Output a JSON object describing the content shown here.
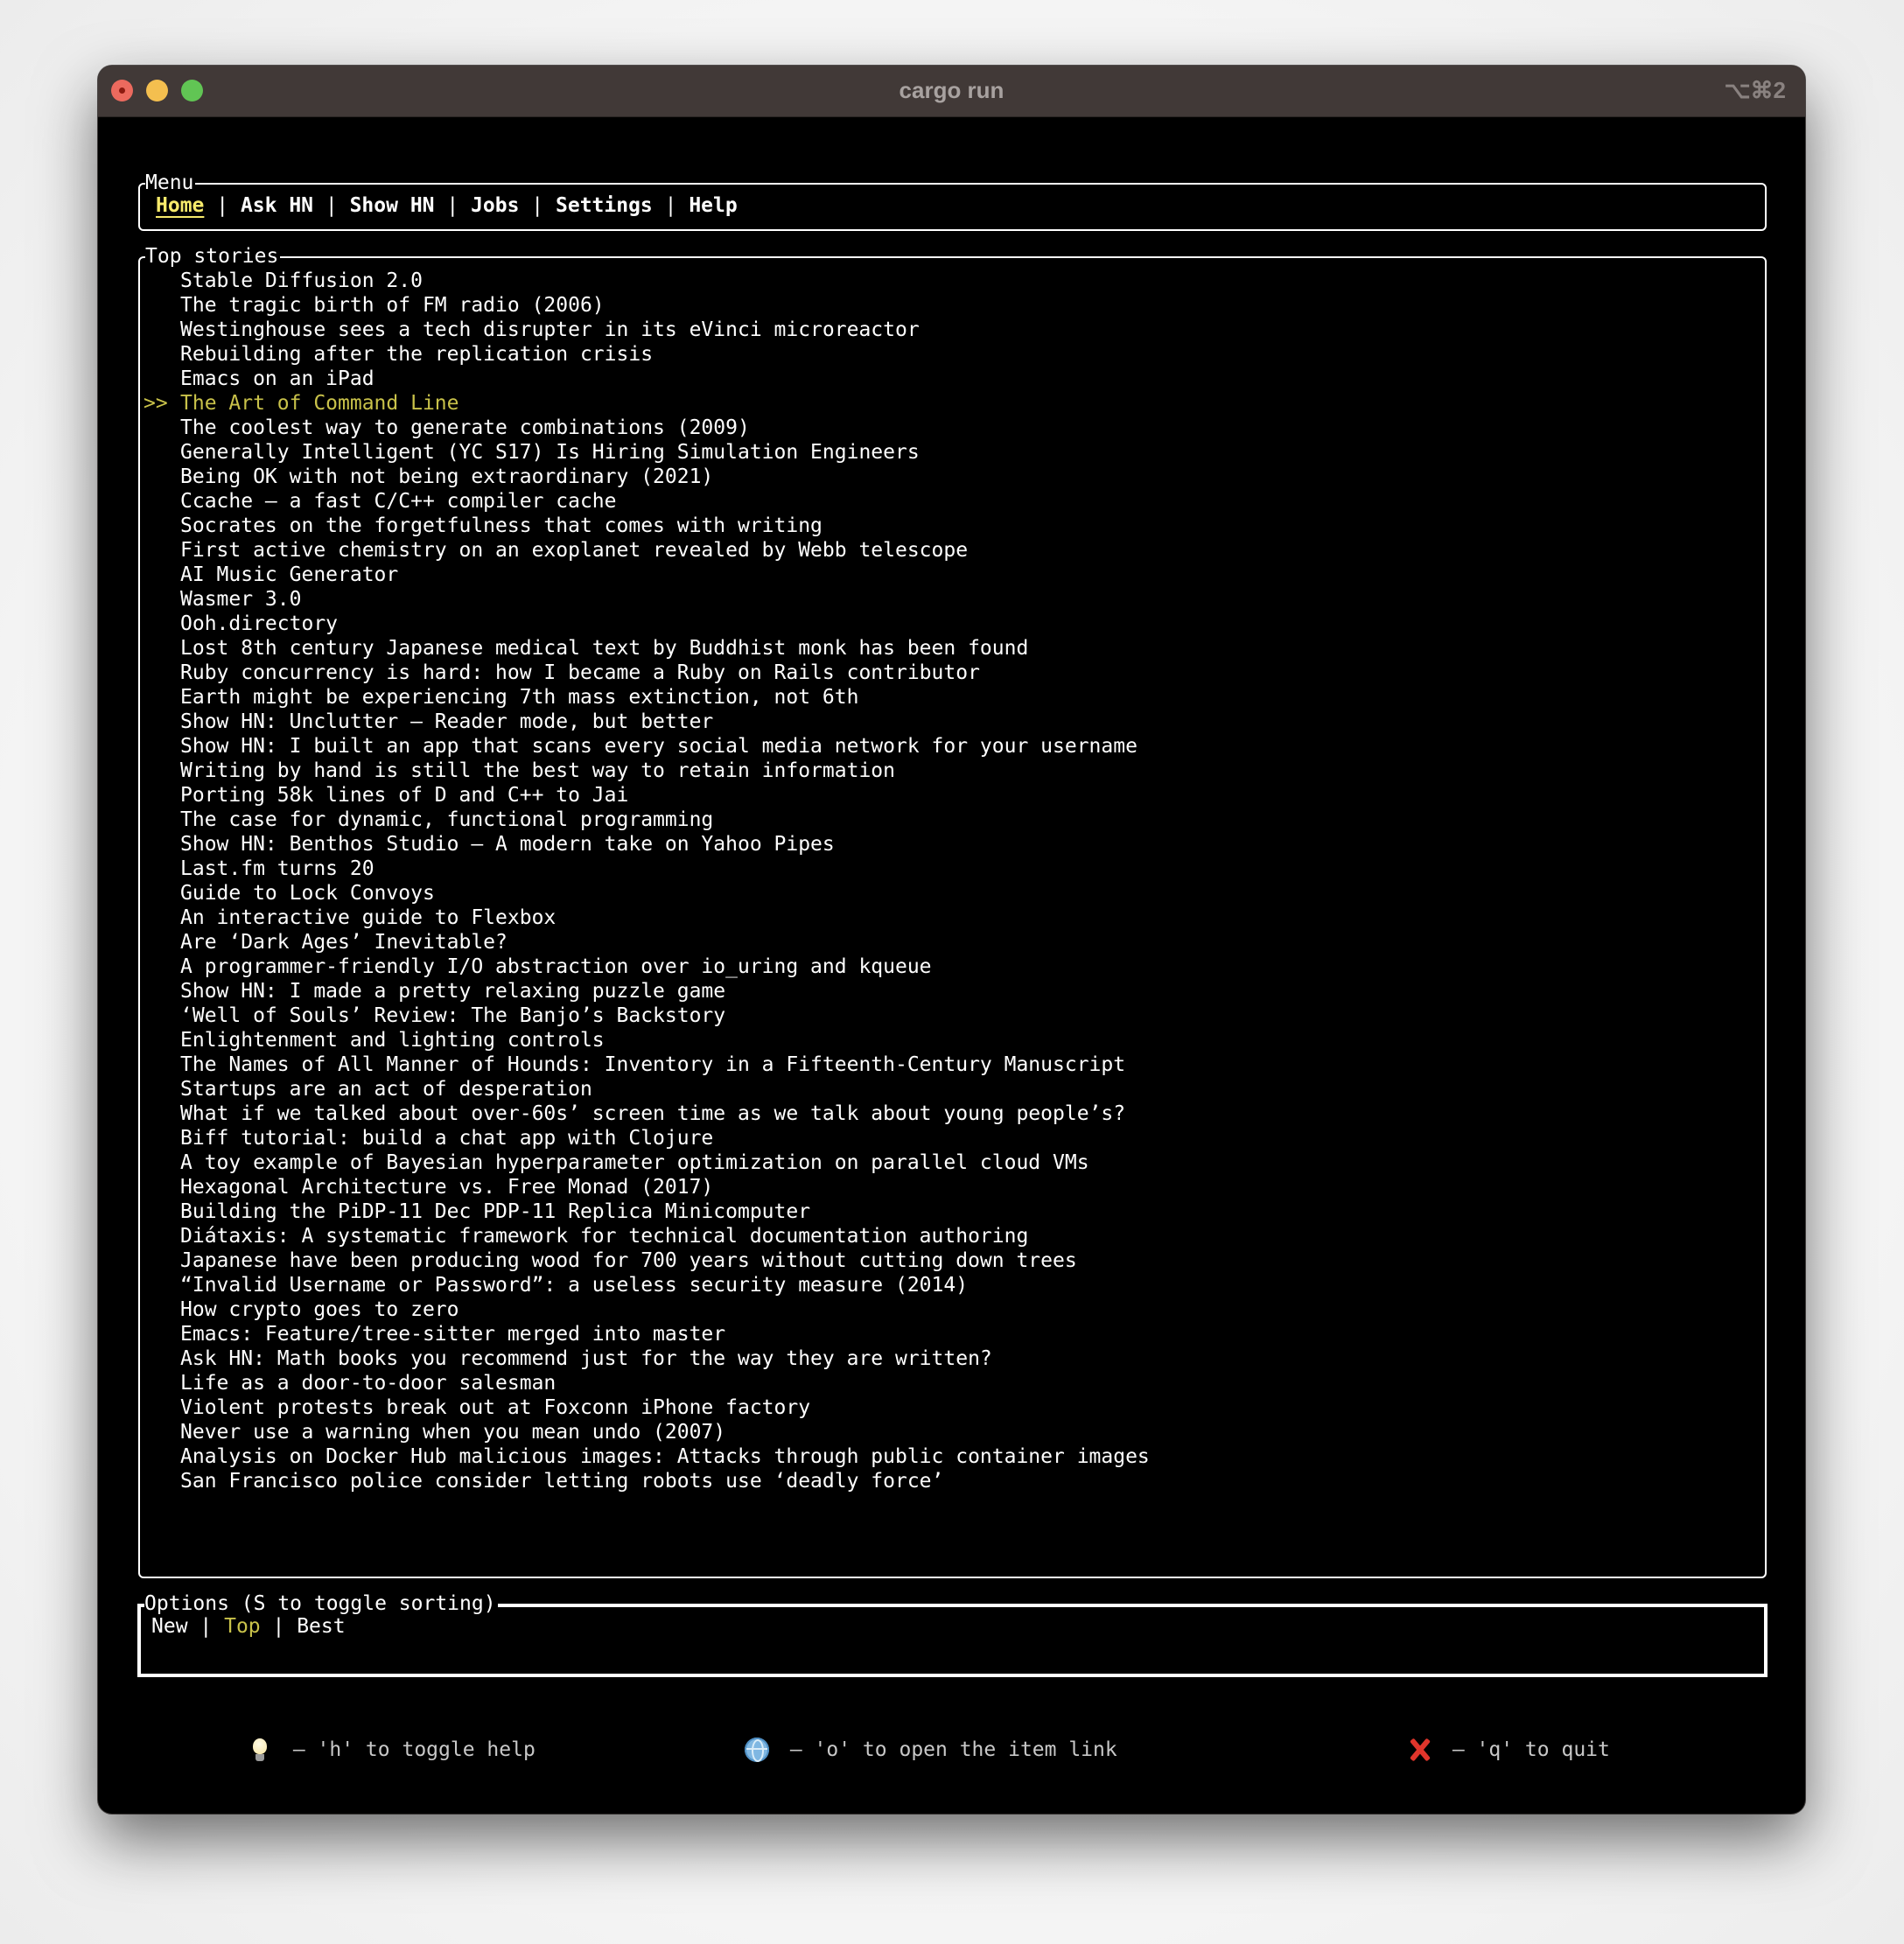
{
  "window": {
    "title": "cargo run",
    "shortcut": "⌥⌘2"
  },
  "menu": {
    "label": "Menu",
    "separator": " | ",
    "items": [
      {
        "label": "Home",
        "active": true
      },
      {
        "label": "Ask HN",
        "active": false
      },
      {
        "label": "Show HN",
        "active": false
      },
      {
        "label": "Jobs",
        "active": false
      },
      {
        "label": "Settings",
        "active": false
      },
      {
        "label": "Help",
        "active": false
      }
    ]
  },
  "stories": {
    "label": "Top stories",
    "selected_marker": ">>",
    "selected_index": 5,
    "items": [
      "Stable Diffusion 2.0",
      "The tragic birth of FM radio (2006)",
      "Westinghouse sees a tech disrupter in its eVinci microreactor",
      "Rebuilding after the replication crisis",
      "Emacs on an iPad",
      "The Art of Command Line",
      "The coolest way to generate combinations (2009)",
      "Generally Intelligent (YC S17) Is Hiring Simulation Engineers",
      "Being OK with not being extraordinary (2021)",
      "Ccache – a fast C/C++ compiler cache",
      "Socrates on the forgetfulness that comes with writing",
      "First active chemistry on an exoplanet revealed by Webb telescope",
      "AI Music Generator",
      "Wasmer 3.0",
      "Ooh.directory",
      "Lost 8th century Japanese medical text by Buddhist monk has been found",
      "Ruby concurrency is hard: how I became a Ruby on Rails contributor",
      "Earth might be experiencing 7th mass extinction, not 6th",
      "Show HN: Unclutter – Reader mode, but better",
      "Show HN: I built an app that scans every social media network for your username",
      "Writing by hand is still the best way to retain information",
      "Porting 58k lines of D and C++ to Jai",
      "The case for dynamic, functional programming",
      "Show HN: Benthos Studio – A modern take on Yahoo Pipes",
      "Last.fm turns 20",
      "Guide to Lock Convoys",
      "An interactive guide to Flexbox",
      "Are ‘Dark Ages’ Inevitable?",
      "A programmer-friendly I/O abstraction over io_uring and kqueue",
      "Show HN: I made a pretty relaxing puzzle game",
      "‘Well of Souls’ Review: The Banjo’s Backstory",
      "Enlightenment and lighting controls",
      "The Names of All Manner of Hounds: Inventory in a Fifteenth-Century Manuscript",
      "Startups are an act of desperation",
      "What if we talked about over-60s’ screen time as we talk about young people’s?",
      "Biff tutorial: build a chat app with Clojure",
      "A toy example of Bayesian hyperparameter optimization on parallel cloud VMs",
      "Hexagonal Architecture vs. Free Monad (2017)",
      "Building the PiDP-11 Dec PDP-11 Replica Minicomputer",
      "Diátaxis: A systematic framework for technical documentation authoring",
      "Japanese have been producing wood for 700 years without cutting down trees",
      "“Invalid Username or Password”: a useless security measure (2014)",
      "How crypto goes to zero",
      "Emacs: Feature/tree-sitter merged into master",
      "Ask HN: Math books you recommend just for the way they are written?",
      "Life as a door-to-door salesman",
      "Violent protests break out at Foxconn iPhone factory",
      "Never use a warning when you mean undo (2007)",
      "Analysis on Docker Hub malicious images: Attacks through public container images",
      "San Francisco police consider letting robots use ‘deadly force’"
    ]
  },
  "options": {
    "label": "Options (S to toggle sorting)",
    "separator": " | ",
    "items": [
      {
        "label": "New",
        "active": false
      },
      {
        "label": "Top",
        "active": true
      },
      {
        "label": "Best",
        "active": false
      }
    ]
  },
  "hints": {
    "help": {
      "icon": "lightbulb-icon",
      "text": " – 'h' to toggle help"
    },
    "open": {
      "icon": "globe-icon",
      "text": " – 'o' to open the item link"
    },
    "quit": {
      "icon": "red-x-icon",
      "text": " – 'q' to quit"
    }
  },
  "colors": {
    "titlebar": "#413937",
    "active_menu": "#f7ea6b",
    "selected": "#c9c24a",
    "text": "#ffffff",
    "hint_text": "#c8c8c8"
  }
}
